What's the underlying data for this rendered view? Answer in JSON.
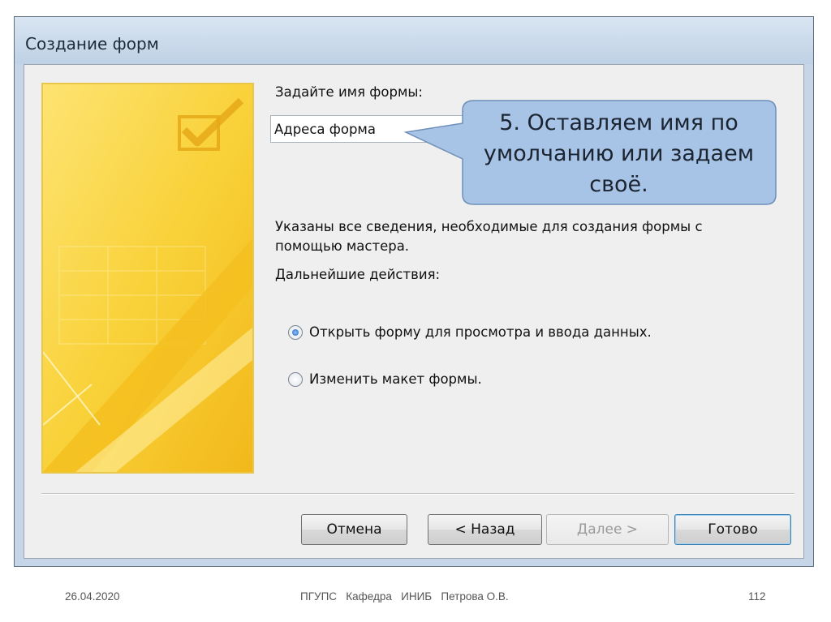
{
  "window": {
    "title": "Создание форм"
  },
  "form_name": {
    "label": "Задайте имя формы:",
    "value": "Адреса форма"
  },
  "info": {
    "text": "Указаны все сведения, необходимые для создания формы с помощью мастера."
  },
  "next_actions": {
    "label": "Дальнейшие действия:",
    "options": [
      {
        "label": "Открыть форму для просмотра и ввода данных.",
        "selected": true
      },
      {
        "label": "Изменить макет формы.",
        "selected": false
      }
    ]
  },
  "buttons": {
    "cancel": "Отмена",
    "back": "< Назад",
    "next": "Далее >",
    "finish": "Готово"
  },
  "callout": {
    "text": "5. Оставляем имя по умолчанию или задаем своё.",
    "fill_color": "#a7c4e6",
    "border_color": "#6f8fb8"
  },
  "art": {
    "primary_color": "#f7cd2a",
    "icon": "checkbox-check-icon"
  },
  "footer": {
    "date": "26.04.2020",
    "center": "ПГУПС   Кафедра   ИНИБ   Петрова О.В.",
    "page": "112"
  }
}
